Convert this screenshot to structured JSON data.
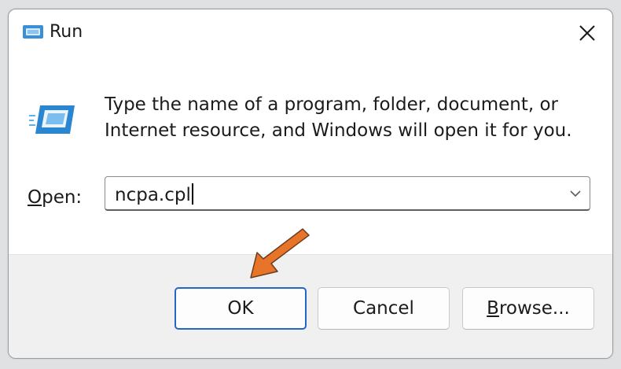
{
  "window": {
    "title": "Run",
    "close_icon": "close-icon",
    "app_icon": "run-app-icon"
  },
  "content": {
    "description_line1": "Type the name of a program, folder, document, or",
    "description_line2": "Internet resource, and Windows will open it for you.",
    "open_label_accel": "O",
    "open_label_rest": "pen:",
    "open_value": "ncpa.cpl",
    "dropdown_icon": "chevron-down-icon"
  },
  "buttons": {
    "ok_label": "OK",
    "cancel_label": "Cancel",
    "browse_accel": "B",
    "browse_rest": "rowse..."
  },
  "colors": {
    "accent": "#2466c4",
    "annotation_arrow": "#e8742a",
    "footer_bg": "#f0f0f0"
  }
}
